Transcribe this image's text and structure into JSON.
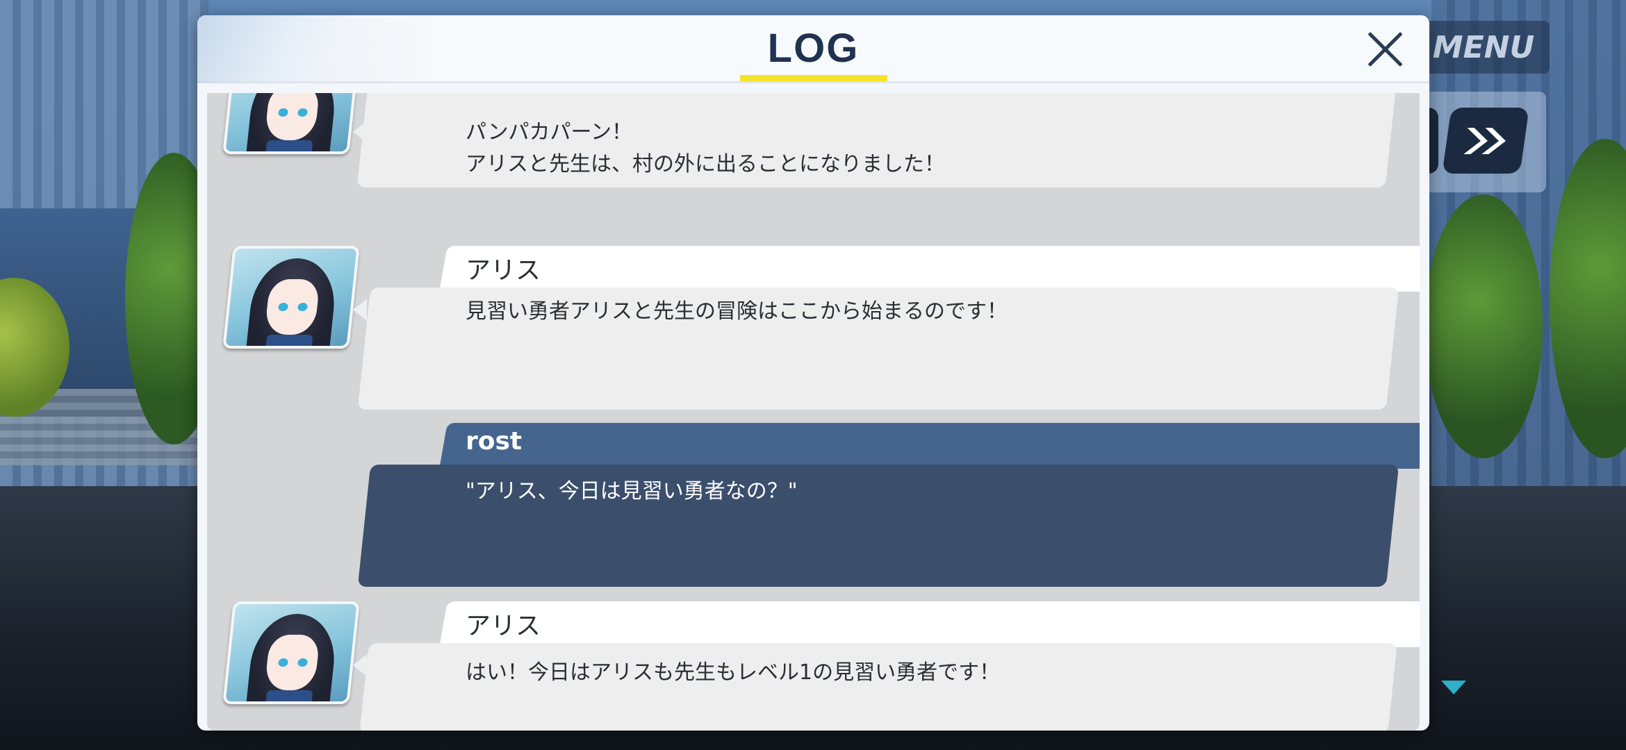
{
  "log": {
    "title": "LOG",
    "entries": [
      {
        "speaker": "",
        "text": "パンパカパーン！\nアリスと先生は、村の外に出ることになりました！",
        "is_player": false
      },
      {
        "speaker": "アリス",
        "text": "見習い勇者アリスと先生の冒険はここから始まるのです！",
        "is_player": false
      },
      {
        "speaker": "rost",
        "text": "\"アリス、今日は見習い勇者なの？\"",
        "is_player": true
      },
      {
        "speaker": "アリス",
        "text": "はい！今日はアリスも先生もレベル1の見習い勇者です！",
        "is_player": false
      }
    ]
  },
  "hud": {
    "menu_label": "MENU",
    "skip_icon": "fast-forward-icon"
  },
  "colors": {
    "title_underline": "#f4e22c",
    "player_name_bar": "#45658f",
    "player_bubble": "#3b4f6c",
    "scroll_indicator": "#2fb0c8"
  }
}
